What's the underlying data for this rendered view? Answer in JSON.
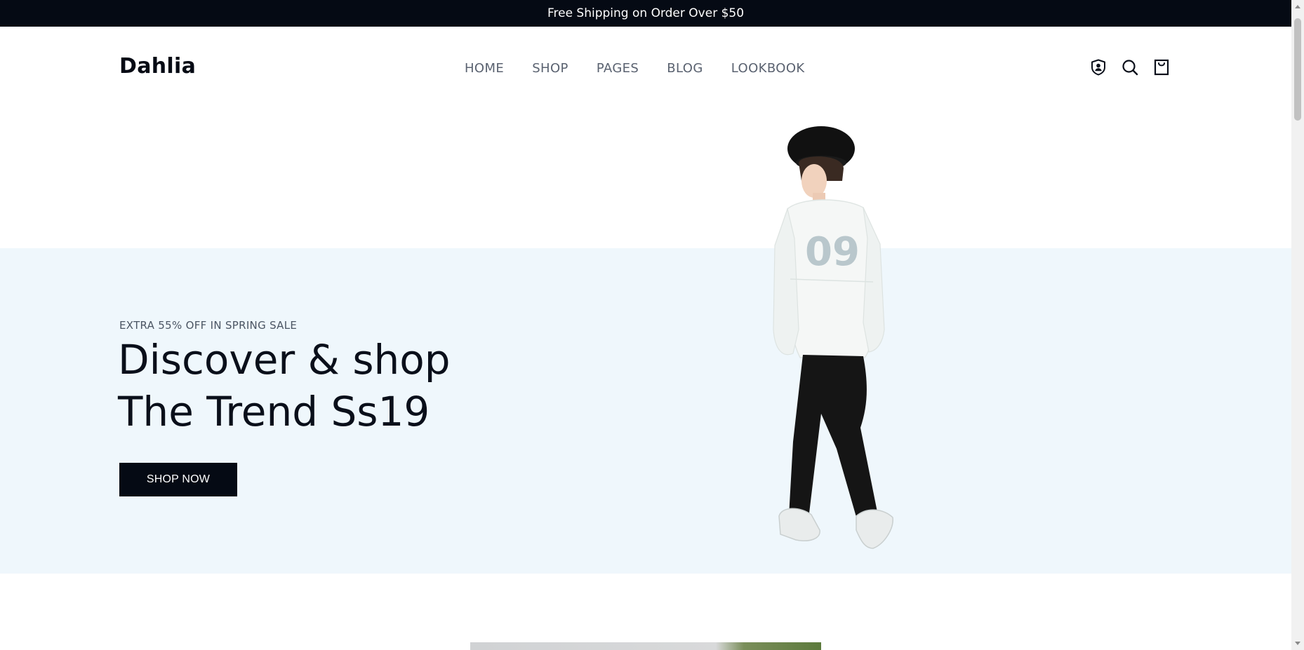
{
  "announcement": {
    "text": "Free Shipping on Order Over $50"
  },
  "header": {
    "logo": "Dahlia",
    "nav": [
      {
        "label": "HOME"
      },
      {
        "label": "SHOP"
      },
      {
        "label": "PAGES"
      },
      {
        "label": "BLOG"
      },
      {
        "label": "LOOKBOOK"
      }
    ],
    "icons": [
      "account-icon",
      "search-icon",
      "shopping-bag-icon"
    ]
  },
  "hero": {
    "eyebrow": "EXTRA 55% OFF IN SPRING SALE",
    "title_line1": "Discover & shop",
    "title_line2": "The Trend Ss19",
    "cta_label": "SHOP NOW",
    "sweatshirt_print": "09"
  },
  "colors": {
    "dark": "#050a14",
    "hero_bg": "#eff7fc",
    "nav_text": "#5a6270"
  }
}
